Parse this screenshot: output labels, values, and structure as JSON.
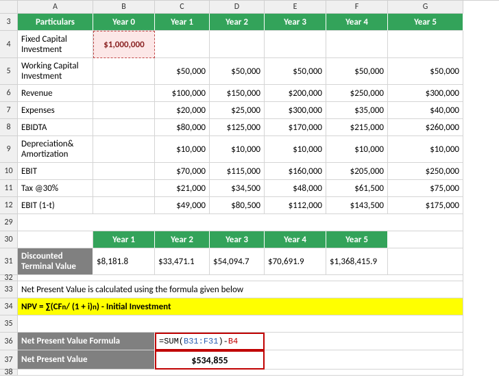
{
  "cols": [
    "A",
    "B",
    "C",
    "D",
    "E",
    "F",
    "G"
  ],
  "t1": {
    "head": [
      "Particulars",
      "Year 0",
      "Year 1",
      "Year 2",
      "Year 3",
      "Year 4",
      "Year 5"
    ],
    "r4": {
      "label": "Fixed Capital Investment",
      "b": "$1,000,000"
    },
    "r5": {
      "label": "Working Capital Investment",
      "c": "$50,000",
      "d": "$50,000",
      "e": "$50,000",
      "f": "$50,000",
      "g": "$50,000"
    },
    "r6": {
      "label": "Revenue",
      "c": "$100,000",
      "d": "$150,000",
      "e": "$200,000",
      "f": "$250,000",
      "g": "$300,000"
    },
    "r7": {
      "label": "Expenses",
      "c": "$20,000",
      "d": "$25,000",
      "e": "$300,000",
      "f": "$35,000",
      "g": "$40,000"
    },
    "r8": {
      "label": "EBIDTA",
      "c": "$80,000",
      "d": "$125,000",
      "e": "$170,000",
      "f": "$215,000",
      "g": "$260,000"
    },
    "r9": {
      "label": "Depreciation& Amortization",
      "c": "$10,000",
      "d": "$10,000",
      "e": "$10,000",
      "f": "$10,000",
      "g": "$10,000"
    },
    "r10": {
      "label": "EBIT",
      "c": "$70,000",
      "d": "$115,000",
      "e": "$160,000",
      "f": "$205,000",
      "g": "$250,000"
    },
    "r11": {
      "label": "Tax @30%",
      "c": "$21,000",
      "d": "$34,500",
      "e": "$48,000",
      "f": "$61,500",
      "g": "$75,000"
    },
    "r12": {
      "label": "EBIT (1-t)",
      "c": "$49,000",
      "d": "$80,500",
      "e": "$112,000",
      "f": "$143,500",
      "g": "$175,000"
    }
  },
  "t2": {
    "head": [
      "Year 1",
      "Year 2",
      "Year 3",
      "Year 4",
      "Year 5"
    ],
    "label": "Discounted Terminal Value",
    "vals": [
      "$8,181.8",
      "$33,471.1",
      "$54,094.7",
      "$70,691.9",
      "$1,368,415.9"
    ]
  },
  "note": "Net Present Value is calculated using the formula given below",
  "formula": {
    "prefix": "NPV = ∑(CF",
    "sub": "n",
    "mid": " / (1 + i)",
    "sup": "n",
    "suffix": ") - Initial Investment"
  },
  "npv": {
    "label1": "Net Present Value Formula",
    "label2": "Net Present Value",
    "f_eq": "=SUM(",
    "f_r1": "B31:F31",
    "f_mid": ")-",
    "f_r2": "B4",
    "result": "$534,855"
  },
  "chart_data": {
    "type": "table",
    "tables": [
      {
        "columns": [
          "Particulars",
          "Year 0",
          "Year 1",
          "Year 2",
          "Year 3",
          "Year 4",
          "Year 5"
        ],
        "rows": [
          [
            "Fixed Capital Investment",
            1000000,
            null,
            null,
            null,
            null,
            null
          ],
          [
            "Working Capital Investment",
            null,
            50000,
            50000,
            50000,
            50000,
            50000
          ],
          [
            "Revenue",
            null,
            100000,
            150000,
            200000,
            250000,
            300000
          ],
          [
            "Expenses",
            null,
            20000,
            25000,
            300000,
            35000,
            40000
          ],
          [
            "EBIDTA",
            null,
            80000,
            125000,
            170000,
            215000,
            260000
          ],
          [
            "Depreciation & Amortization",
            null,
            10000,
            10000,
            10000,
            10000,
            10000
          ],
          [
            "EBIT",
            null,
            70000,
            115000,
            160000,
            205000,
            250000
          ],
          [
            "Tax @30%",
            null,
            21000,
            34500,
            48000,
            61500,
            75000
          ],
          [
            "EBIT (1-t)",
            null,
            49000,
            80500,
            112000,
            143500,
            175000
          ]
        ]
      },
      {
        "columns": [
          "Year 1",
          "Year 2",
          "Year 3",
          "Year 4",
          "Year 5"
        ],
        "rows": [
          [
            "Discounted Terminal Value",
            8181.8,
            33471.1,
            54094.7,
            70691.9,
            1368415.9
          ]
        ]
      }
    ],
    "npv_formula": "=SUM(B31:F31)-B4",
    "npv_result": 534855
  }
}
